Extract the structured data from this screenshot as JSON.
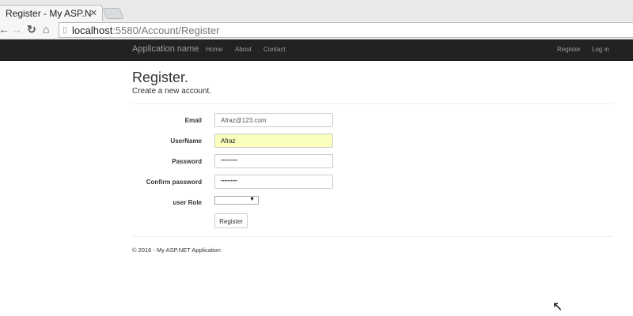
{
  "browser": {
    "tab_title": "Register - My ASP.N",
    "url_host": "localhost",
    "url_rest": ":5580/Account/Register"
  },
  "navbar": {
    "brand": "Application name",
    "links": [
      "Home",
      "About",
      "Contact"
    ],
    "right": [
      "Register",
      "Log in"
    ]
  },
  "page": {
    "title": "Register.",
    "subtitle": "Create a new account."
  },
  "form": {
    "email_label": "Email",
    "email_value": "Afraz@123.com",
    "username_label": "UserName",
    "username_value": "Afraz",
    "password_label": "Password",
    "password_value": "••••••••••",
    "confirm_label": "Confirm password",
    "confirm_value": "••••••••••",
    "role_label": "user Role",
    "role_value": "",
    "submit": "Register"
  },
  "footer": "© 2016 - My ASP.NET Application",
  "colors": {
    "autofill": "#faffbd",
    "navbar": "#222222"
  }
}
